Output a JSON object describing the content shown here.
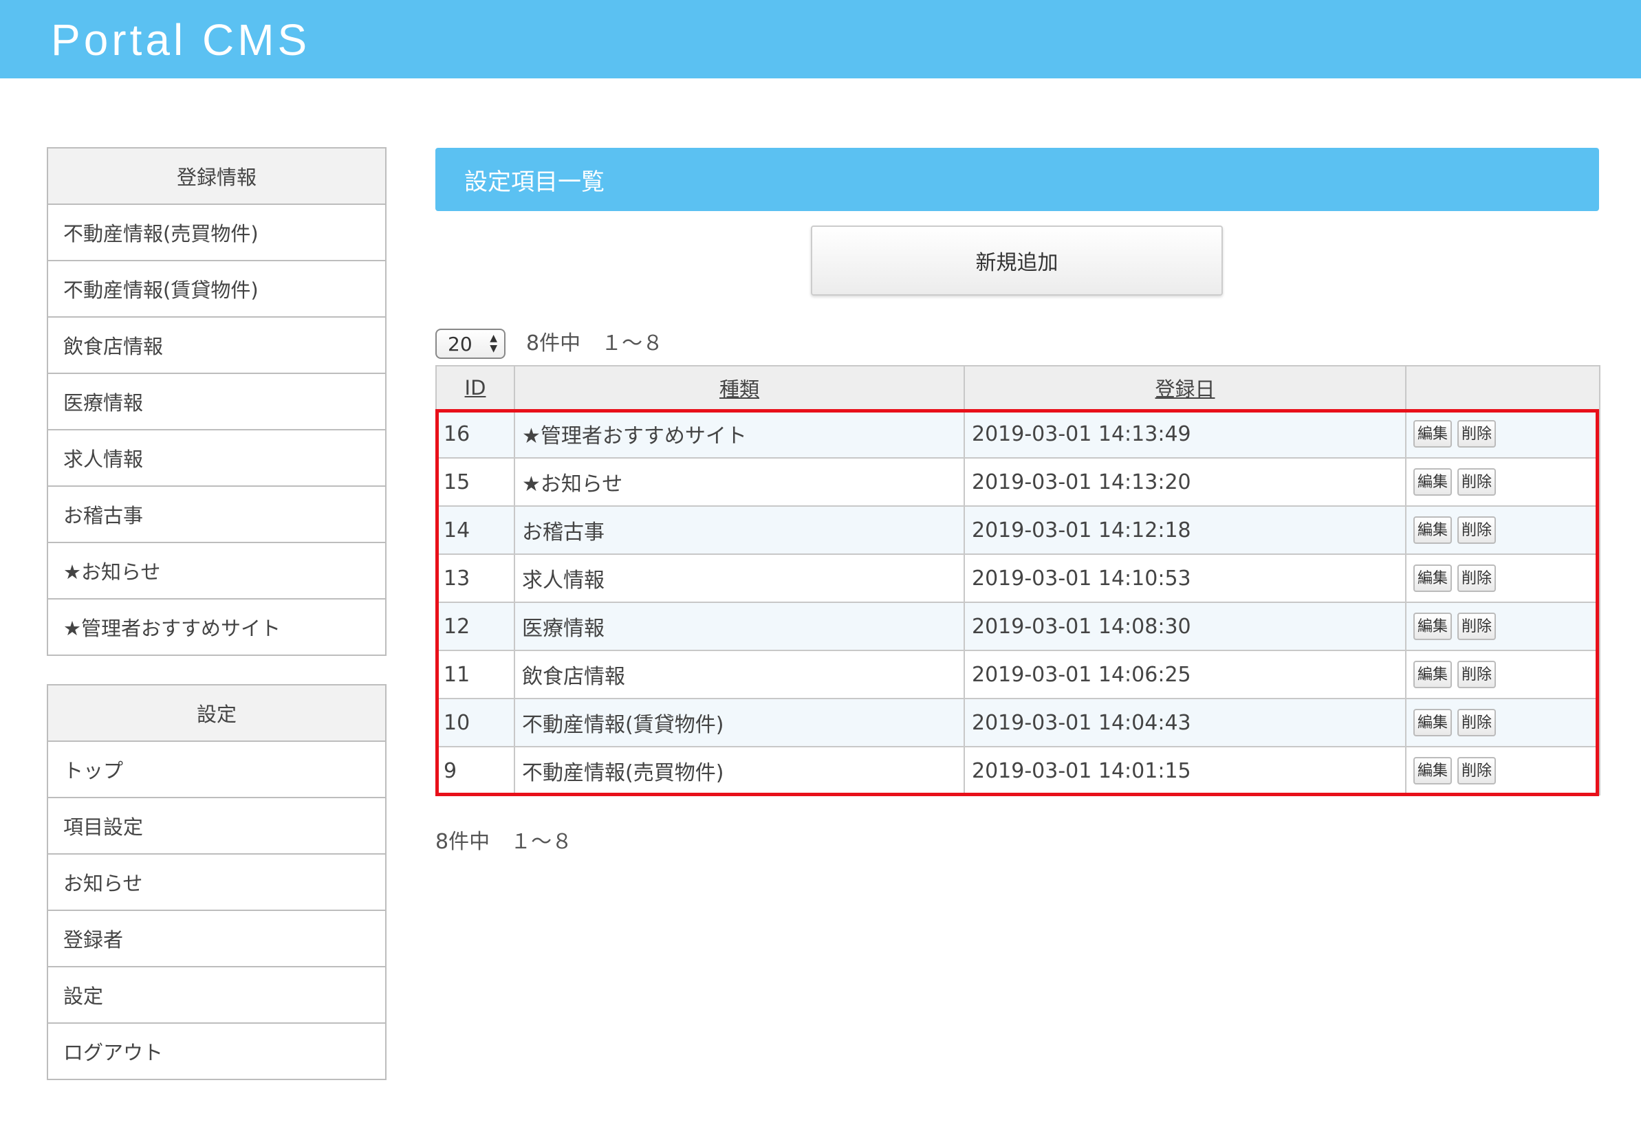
{
  "header": {
    "brand": "Portal CMS"
  },
  "sidebar": {
    "registration": {
      "title": "登録情報",
      "items": [
        "不動産情報(売買物件)",
        "不動産情報(賃貸物件)",
        "飲食店情報",
        "医療情報",
        "求人情報",
        "お稽古事",
        "★お知らせ",
        "★管理者おすすめサイト"
      ]
    },
    "settings": {
      "title": "設定",
      "items": [
        "トップ",
        "項目設定",
        "お知らせ",
        "登録者",
        "設定",
        "ログアウト"
      ]
    }
  },
  "main": {
    "title": "設定項目一覧",
    "add_button": "新規追加",
    "per_page": "20",
    "count_text": "8件中　１～８",
    "table": {
      "headers": [
        "ID",
        "種類",
        "登録日",
        ""
      ],
      "rows": [
        {
          "id": "16",
          "type": "★管理者おすすめサイト",
          "date": "2019-03-01 14:13:49"
        },
        {
          "id": "15",
          "type": "★お知らせ",
          "date": "2019-03-01 14:13:20"
        },
        {
          "id": "14",
          "type": "お稽古事",
          "date": "2019-03-01 14:12:18"
        },
        {
          "id": "13",
          "type": "求人情報",
          "date": "2019-03-01 14:10:53"
        },
        {
          "id": "12",
          "type": "医療情報",
          "date": "2019-03-01 14:08:30"
        },
        {
          "id": "11",
          "type": "飲食店情報",
          "date": "2019-03-01 14:06:25"
        },
        {
          "id": "10",
          "type": "不動産情報(賃貸物件)",
          "date": "2019-03-01 14:04:43"
        },
        {
          "id": "9",
          "type": "不動産情報(売買物件)",
          "date": "2019-03-01 14:01:15"
        }
      ],
      "edit_label": "編集",
      "delete_label": "削除"
    }
  },
  "colors": {
    "header_bg": "#5bc1f2",
    "highlight_border": "#e8101a"
  }
}
